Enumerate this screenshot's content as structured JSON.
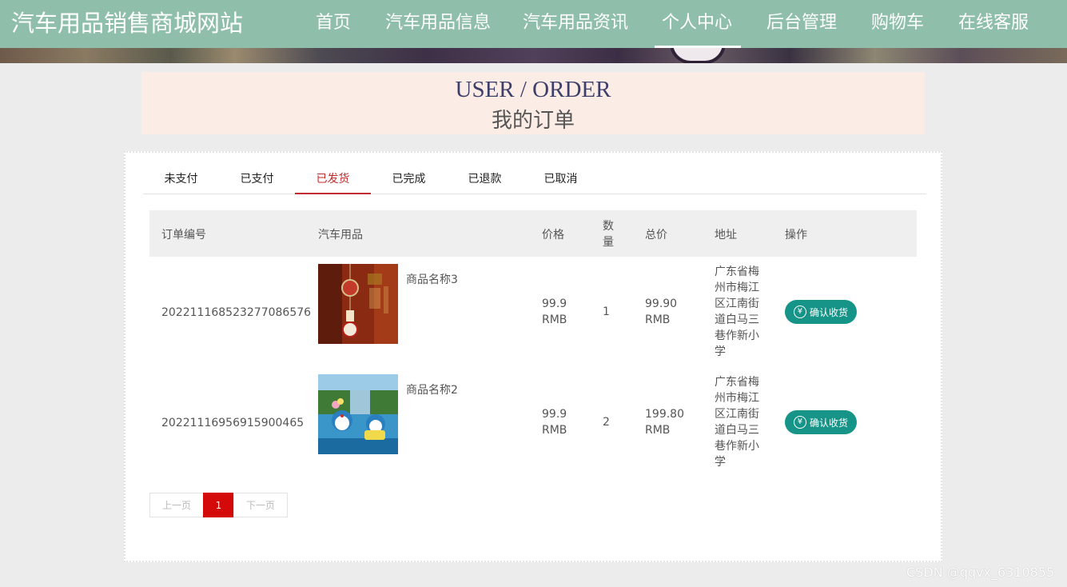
{
  "site": {
    "title": "汽车用品销售商城网站"
  },
  "nav": {
    "items": [
      "首页",
      "汽车用品信息",
      "汽车用品资讯",
      "个人中心",
      "后台管理",
      "购物车",
      "在线客服"
    ],
    "active": "个人中心"
  },
  "page": {
    "title_en": "USER / ORDER",
    "title_cn": "我的订单"
  },
  "tabs": {
    "items": [
      "未支付",
      "已支付",
      "已发货",
      "已完成",
      "已退款",
      "已取消"
    ],
    "active": "已发货"
  },
  "table": {
    "headers": {
      "order_no": "订单编号",
      "product": "汽车用品",
      "price": "价格",
      "qty": "数量",
      "total": "总价",
      "address": "地址",
      "action": "操作"
    },
    "rows": [
      {
        "order_no": "20221116852327708657 6",
        "product_name": "商品名称3",
        "price": "99.9 RMB",
        "qty": "1",
        "total": "99.90 RMB",
        "address": "广东省梅州市梅江区江南街道白马三巷作新小学",
        "action_label": "确认收货",
        "thumb_icon": "product-ornament-image"
      },
      {
        "order_no": "20221116956915900465",
        "product_name": "商品名称2",
        "price": "99.9 RMB",
        "qty": "2",
        "total": "199.80 RMB",
        "address": "广东省梅州市梅江区江南街道白马三巷作新小学",
        "action_label": "确认收货",
        "thumb_icon": "product-doraemon-image"
      }
    ]
  },
  "pagination": {
    "prev": "上一页",
    "current": "1",
    "next": "下一页"
  },
  "watermark": "CSDN @qqvx_6310855",
  "colors": {
    "nav_bg": "#8fbfab",
    "accent_red": "#c32c2c",
    "button_teal": "#169488",
    "page_active": "#d40a0a"
  }
}
